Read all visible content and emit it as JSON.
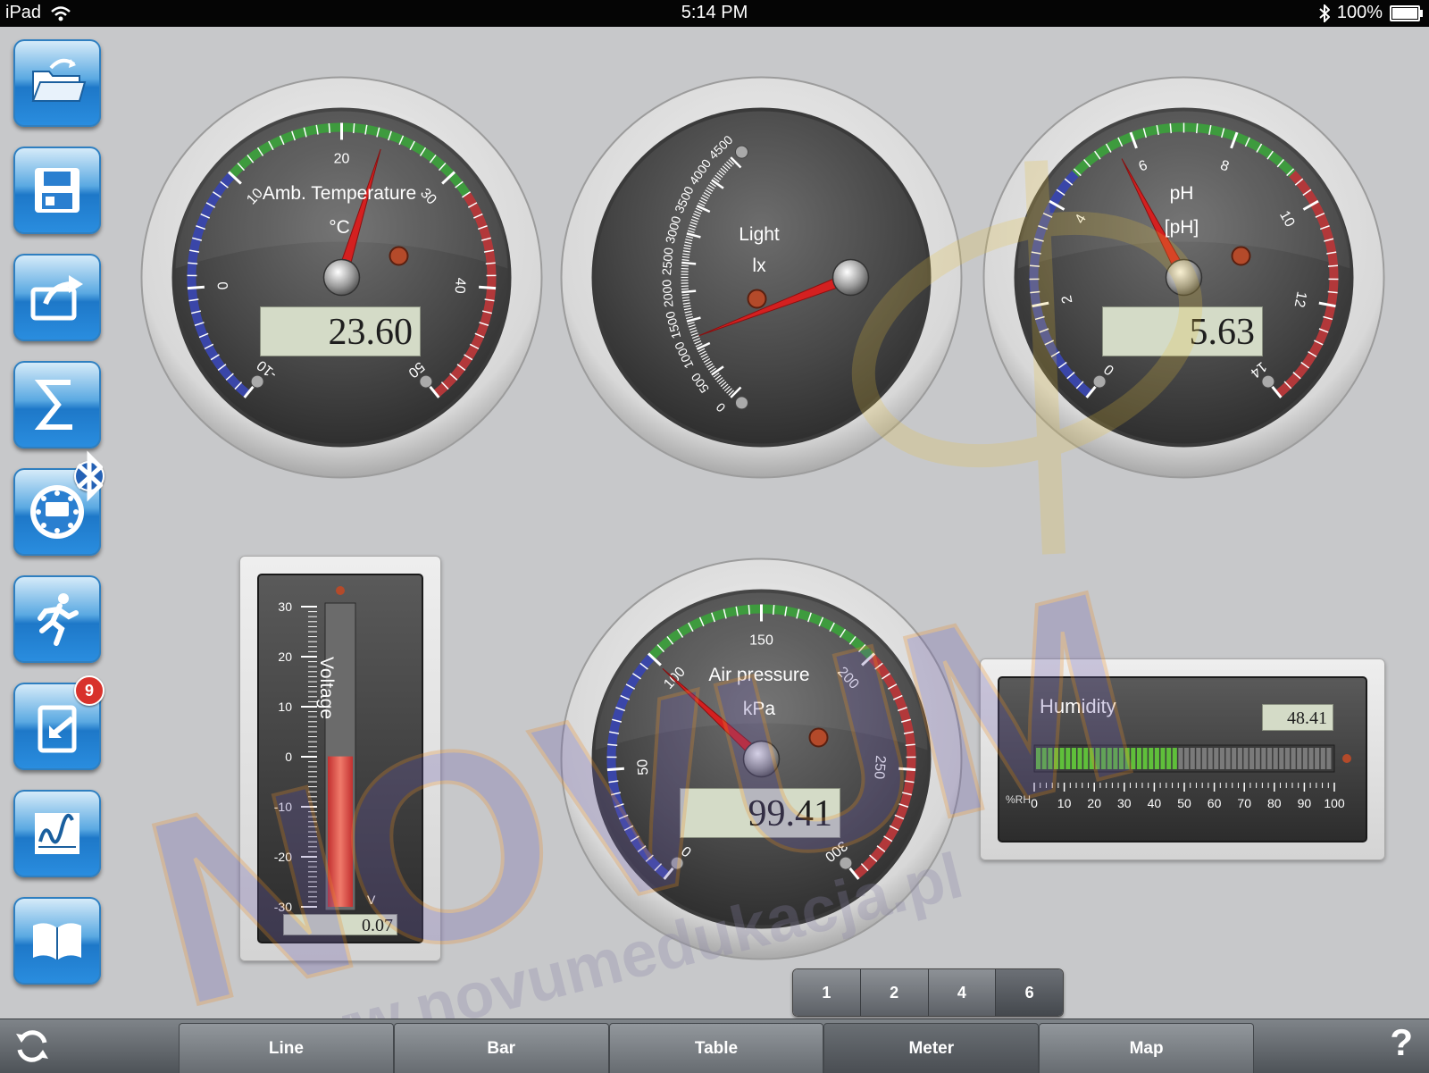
{
  "status_bar": {
    "device": "iPad",
    "time": "5:14 PM",
    "battery": "100%"
  },
  "sidebar": {
    "items": [
      {
        "name": "open-folder",
        "icon": "folder-open-icon"
      },
      {
        "name": "save",
        "icon": "floppy-disk-icon"
      },
      {
        "name": "export",
        "icon": "share-arrow-icon"
      },
      {
        "name": "statistics",
        "icon": "sigma-icon"
      },
      {
        "name": "sensor",
        "icon": "sensor-dial-icon",
        "badge": "bluetooth"
      },
      {
        "name": "activity",
        "icon": "running-man-icon"
      },
      {
        "name": "import",
        "icon": "tablet-import-icon",
        "badge": "9"
      },
      {
        "name": "graph",
        "icon": "graph-window-icon"
      },
      {
        "name": "help-book",
        "icon": "open-book-icon"
      }
    ]
  },
  "gauges": {
    "temperature": {
      "title": "Amb. Temperature",
      "unit": "°C",
      "value": "23.60",
      "ticks": [
        "-10",
        "0",
        "10",
        "20",
        "30",
        "40",
        "50"
      ],
      "min": -10,
      "max": 50,
      "reading": 23.6
    },
    "light": {
      "title": "Light",
      "unit": "lx",
      "ticks": [
        "0",
        "500",
        "1000",
        "1500",
        "2000",
        "2500",
        "3000",
        "3500",
        "4000",
        "4500"
      ],
      "min": 0,
      "max": 4500,
      "reading": 1200
    },
    "ph": {
      "title": "pH",
      "unit": "[pH]",
      "value": "5.63",
      "ticks": [
        "0",
        "2",
        "4",
        "6",
        "8",
        "10",
        "12",
        "14"
      ],
      "min": 0,
      "max": 14,
      "reading": 5.63
    },
    "pressure": {
      "title": "Air pressure",
      "unit": "kPa",
      "value": "99.41",
      "ticks": [
        "0",
        "50",
        "100",
        "150",
        "200",
        "250",
        "300"
      ],
      "min": 0,
      "max": 300,
      "reading": 99.41
    }
  },
  "voltage": {
    "title": "Voltage",
    "unit": "V",
    "value": "0.07",
    "ticks": [
      "30",
      "20",
      "10",
      "0",
      "-10",
      "-20",
      "-30"
    ],
    "min": -30,
    "max": 30,
    "reading": 0.07
  },
  "humidity": {
    "title": "Humidity",
    "unit": "%RH",
    "value": "48.41",
    "ticks": [
      "0",
      "10",
      "20",
      "30",
      "40",
      "50",
      "60",
      "70",
      "80",
      "90",
      "100"
    ],
    "reading": 48.41
  },
  "pager": [
    "1",
    "2",
    "4",
    "6"
  ],
  "tabs": [
    "Line",
    "Bar",
    "Table",
    "Meter",
    "Map"
  ],
  "active_tab": "Meter",
  "help_label": "?",
  "watermark": {
    "brand": "NOVUM",
    "url": "www.novumedukacja.pl"
  }
}
